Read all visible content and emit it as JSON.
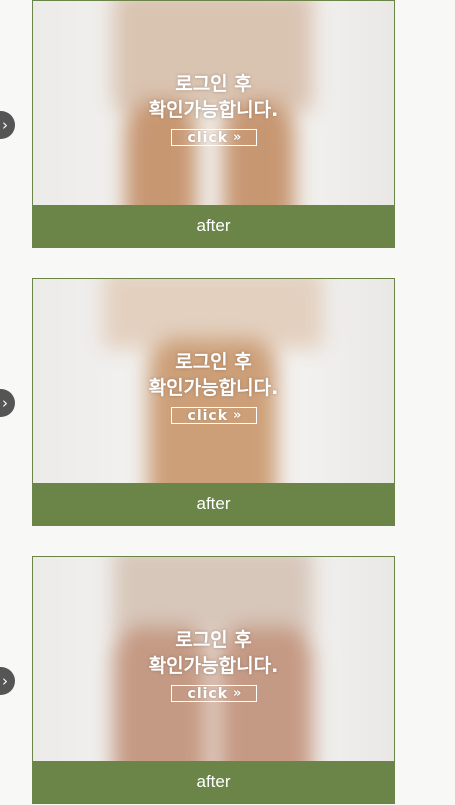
{
  "cards": [
    {
      "login_line1": "로그인 후",
      "login_line2": "확인가능합니다.",
      "click_label": "click",
      "click_icon": "»",
      "caption": "after",
      "nav_icon": "›"
    },
    {
      "login_line1": "로그인 후",
      "login_line2": "확인가능합니다.",
      "click_label": "click",
      "click_icon": "»",
      "caption": "after",
      "nav_icon": "›"
    },
    {
      "login_line1": "로그인 후",
      "login_line2": "확인가능합니다.",
      "click_label": "click",
      "click_icon": "»",
      "caption": "after",
      "nav_icon": "›"
    }
  ],
  "colors": {
    "caption_bg": "#6b8548",
    "nav_button_bg": "#555555",
    "page_bg": "#f8f8f6"
  }
}
